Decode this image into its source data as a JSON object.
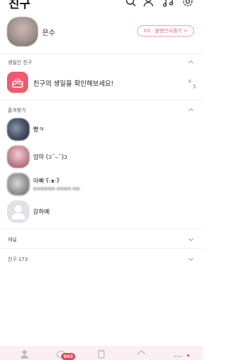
{
  "header": {
    "title": "친구"
  },
  "profile": {
    "name": "은수",
    "status_message": "XX · 블밴안사줌기 >"
  },
  "sections": {
    "birthday": {
      "label": "생일인 친구",
      "text": "친구의 생일을 확인해보세요!",
      "count": "4"
    },
    "favorites": {
      "label": "즐겨찾기",
      "friends": [
        {
          "name": "빵ㅋ",
          "message": ""
        },
        {
          "name": "엄마 (ɔ˘⌣˘)ɔ",
          "message": ""
        },
        {
          "name": "아빠 ʕ·ᴥ·ʔ",
          "message": "●●●●●● ●●●● ●●"
        },
        {
          "name": "강하예",
          "message": ""
        }
      ]
    },
    "channel": {
      "label": "채널"
    },
    "friends": {
      "label": "친구 173"
    }
  },
  "bottom_nav": {
    "badge": "903",
    "items": [
      "friends-tab",
      "chat-tab",
      "view-tab",
      "shopping-tab",
      "more-tab"
    ]
  },
  "colors": {
    "accent": "#ef5a6c",
    "badge": "#e8445a",
    "nav_bg": "#fbeff2"
  }
}
